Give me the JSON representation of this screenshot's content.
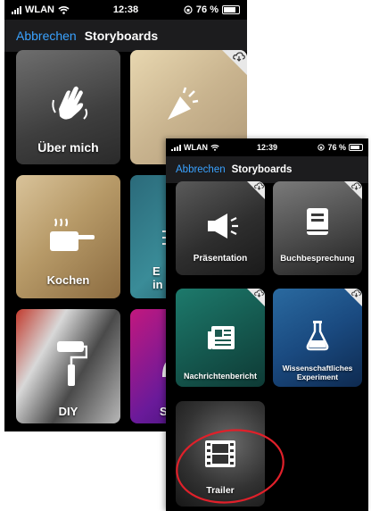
{
  "back_screen": {
    "status": {
      "carrier": "WLAN",
      "time": "12:38",
      "battery": "76 %"
    },
    "nav": {
      "cancel_label": "Abbrechen",
      "title": "Storyboards"
    },
    "tiles": [
      {
        "label": "Über mich",
        "icon": "waving-hand-icon"
      },
      {
        "label": "",
        "icon": "party-popper-icon"
      },
      {
        "label": "Kochen",
        "icon": "cooking-pot-icon"
      },
      {
        "label": "E\nin",
        "icon": "partial-icon"
      },
      {
        "label": "DIY",
        "icon": "paint-roller-icon"
      },
      {
        "label": "S",
        "icon": "partial-icon"
      }
    ]
  },
  "front_screen": {
    "status": {
      "carrier": "WLAN",
      "time": "12:39",
      "battery": "76 %"
    },
    "nav": {
      "cancel_label": "Abbrechen",
      "title": "Storyboards"
    },
    "tiles": [
      {
        "label": "Präsentation",
        "icon": "megaphone-icon"
      },
      {
        "label": "Buchbesprechung",
        "icon": "book-icon"
      },
      {
        "label": "Nachrichtenbericht",
        "icon": "newspaper-icon"
      },
      {
        "label": "Wissenschaftliches Experiment",
        "icon": "flask-icon"
      },
      {
        "label": "Trailer",
        "icon": "film-strip-icon"
      }
    ]
  },
  "annotation": {
    "shape": "red-circle",
    "color": "#e0202a"
  },
  "colors": {
    "accent": "#3aa2ff",
    "nav_bg": "#1c1c1e",
    "background": "#000000"
  }
}
